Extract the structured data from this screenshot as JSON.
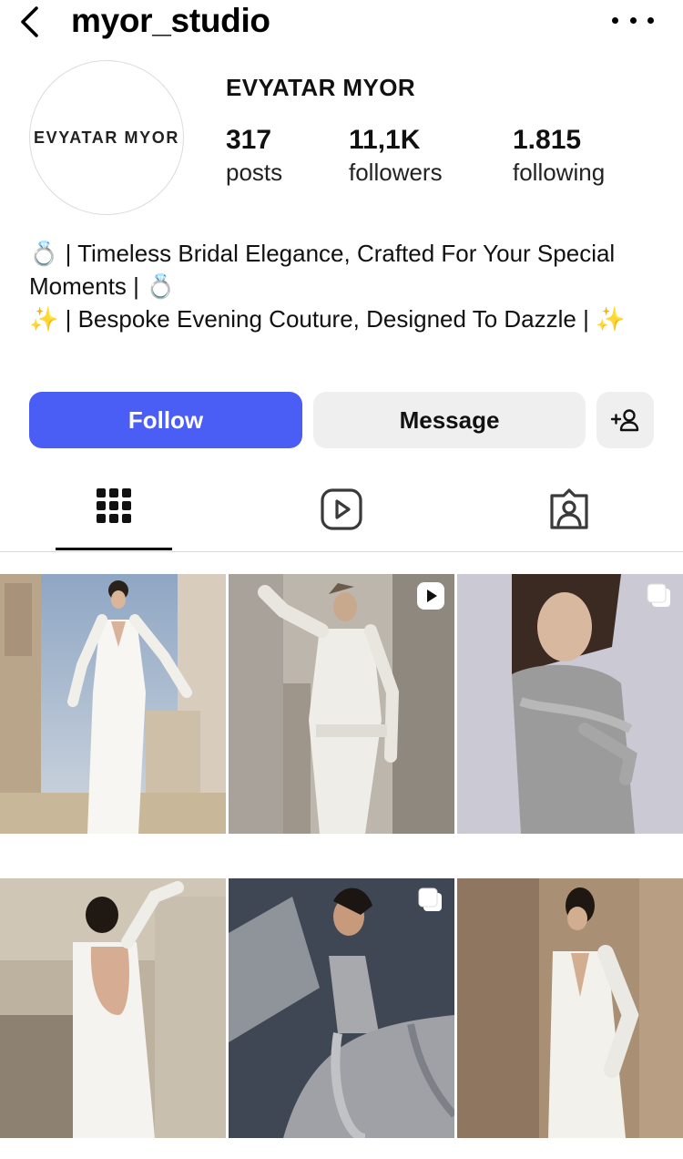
{
  "header": {
    "username": "myor_studio",
    "back_icon": "chevron-left-icon",
    "more_icon": "more-horizontal-icon"
  },
  "profile": {
    "avatar_text": "EVYATAR MYOR",
    "display_name": "EVYATAR MYOR",
    "stats": [
      {
        "value": "317",
        "label": "posts"
      },
      {
        "value": "11,1K",
        "label": "followers"
      },
      {
        "value": "1.815",
        "label": "following"
      }
    ],
    "bio_lines": [
      "💍 | Timeless Bridal Elegance, Crafted For Your Special Moments | 💍",
      "✨ | Bespoke Evening Couture, Designed To Dazzle | ✨"
    ]
  },
  "actions": {
    "follow_label": "Follow",
    "message_label": "Message",
    "add_user_icon": "add-person-icon"
  },
  "tabs": [
    {
      "icon": "grid-icon",
      "active": true
    },
    {
      "icon": "reels-icon",
      "active": false
    },
    {
      "icon": "tagged-icon",
      "active": false
    }
  ],
  "grid": [
    {
      "name": "post-1",
      "badge": null
    },
    {
      "name": "post-2",
      "badge": "reel-icon"
    },
    {
      "name": "post-3",
      "badge": "carousel-icon"
    },
    {
      "name": "post-4",
      "badge": null
    },
    {
      "name": "post-5",
      "badge": "carousel-icon"
    },
    {
      "name": "post-6",
      "badge": null
    }
  ],
  "colors": {
    "follow_button": "#4a5df5",
    "secondary_button": "#efefef",
    "divider": "#dbdbdb"
  }
}
